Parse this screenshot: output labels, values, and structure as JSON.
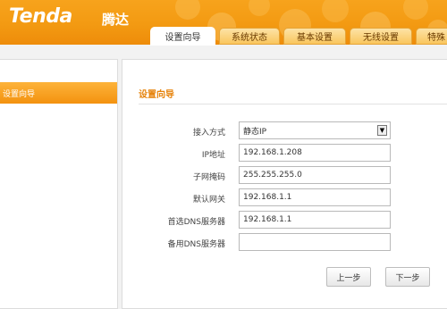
{
  "brand": {
    "logo": "Tenda",
    "logo_cn": "腾达",
    "accent": "#f39a12"
  },
  "tabs": [
    {
      "label": "设置向导",
      "active": true
    },
    {
      "label": "系统状态"
    },
    {
      "label": "基本设置"
    },
    {
      "label": "无线设置"
    },
    {
      "label": "特殊"
    }
  ],
  "sidebar": {
    "items": [
      {
        "label": "设置向导",
        "selected": true
      }
    ]
  },
  "main": {
    "title": "设置向导",
    "form": {
      "access_mode": {
        "label": "接入方式",
        "value": "静态IP"
      },
      "ip": {
        "label": "IP地址",
        "value": "192.168.1.208"
      },
      "subnet": {
        "label": "子网掩码",
        "value": "255.255.255.0"
      },
      "gateway": {
        "label": "默认网关",
        "value": "192.168.1.1"
      },
      "dns_primary": {
        "label": "首选DNS服务器",
        "value": "192.168.1.1"
      },
      "dns_secondary": {
        "label": "备用DNS服务器",
        "value": ""
      }
    },
    "buttons": {
      "prev": "上一步",
      "next": "下一步"
    }
  }
}
